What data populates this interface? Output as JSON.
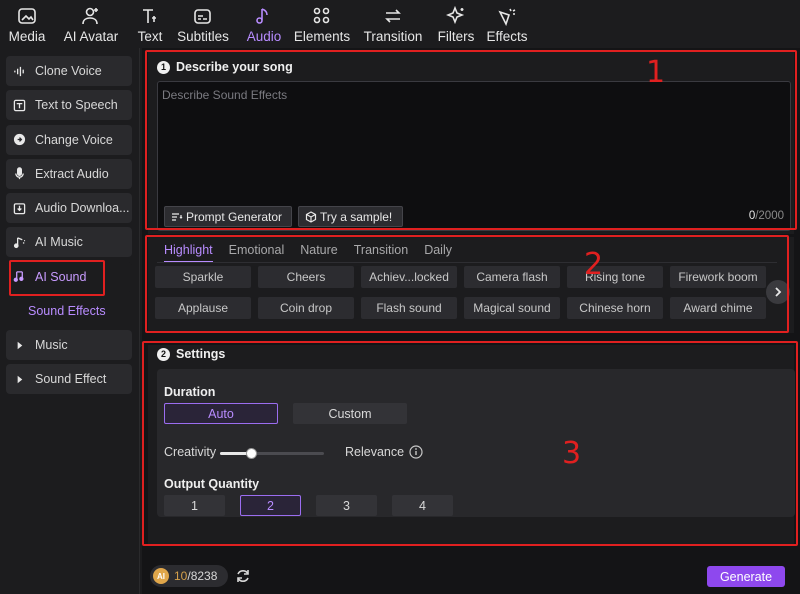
{
  "toolbar": {
    "items": [
      {
        "label": "Media",
        "icon": "media-icon"
      },
      {
        "label": "AI Avatar",
        "icon": "avatar-icon"
      },
      {
        "label": "Text",
        "icon": "text-icon"
      },
      {
        "label": "Subtitles",
        "icon": "subtitles-icon"
      },
      {
        "label": "Audio",
        "icon": "audio-icon",
        "active": true
      },
      {
        "label": "Elements",
        "icon": "elements-icon"
      },
      {
        "label": "Transition",
        "icon": "transition-icon"
      },
      {
        "label": "Filters",
        "icon": "filters-icon"
      },
      {
        "label": "Effects",
        "icon": "effects-icon"
      }
    ]
  },
  "sidebar": {
    "items": [
      {
        "label": "Clone Voice",
        "icon": "waveform-icon"
      },
      {
        "label": "Text to Speech",
        "icon": "text-speech-icon"
      },
      {
        "label": "Change Voice",
        "icon": "change-voice-icon"
      },
      {
        "label": "Extract Audio",
        "icon": "microphone-icon"
      },
      {
        "label": "Audio Downloa...",
        "icon": "download-icon"
      },
      {
        "label": "AI Music",
        "icon": "music-note-icon"
      },
      {
        "label": "AI Sound",
        "icon": "ai-sound-icon",
        "active": true
      }
    ],
    "sub_item": "Sound Effects",
    "groups": [
      {
        "label": "Music",
        "icon": "caret-right-icon"
      },
      {
        "label": "Sound Effect",
        "icon": "caret-right-icon"
      }
    ]
  },
  "describe": {
    "step": "1",
    "title": "Describe your song",
    "placeholder": "Describe Sound Effects",
    "prompt_generator": "Prompt Generator",
    "try_sample": "Try a sample!",
    "count": "0",
    "limit": "/2000"
  },
  "categories": {
    "tabs": [
      "Highlight",
      "Emotional",
      "Nature",
      "Transition",
      "Daily"
    ],
    "active_tab": "Highlight",
    "chips_row1": [
      "Sparkle",
      "Cheers",
      "Achiev...locked",
      "Camera flash",
      "Rising tone",
      "Firework boom"
    ],
    "chips_row2": [
      "Applause",
      "Coin drop",
      "Flash sound",
      "Magical sound",
      "Chinese horn",
      "Award chime"
    ]
  },
  "settings": {
    "step": "2",
    "title": "Settings",
    "duration_label": "Duration",
    "duration_options": [
      "Auto",
      "Custom"
    ],
    "duration_selected": "Auto",
    "creativity_label": "Creativity",
    "relevance_label": "Relevance",
    "slider_value": 0.3,
    "quantity_label": "Output Quantity",
    "quantity_options": [
      "1",
      "2",
      "3",
      "4"
    ],
    "quantity_selected": "2"
  },
  "footer": {
    "coin_label": "AI",
    "credits_current": "10",
    "credits_total": "/8238",
    "generate_label": "Generate"
  },
  "annotations": {
    "marker1": "1",
    "marker2": "2",
    "marker3": "3"
  },
  "colors": {
    "accent": "#b88cff",
    "generate": "#8e48ee",
    "annotation_red": "#e02020"
  }
}
